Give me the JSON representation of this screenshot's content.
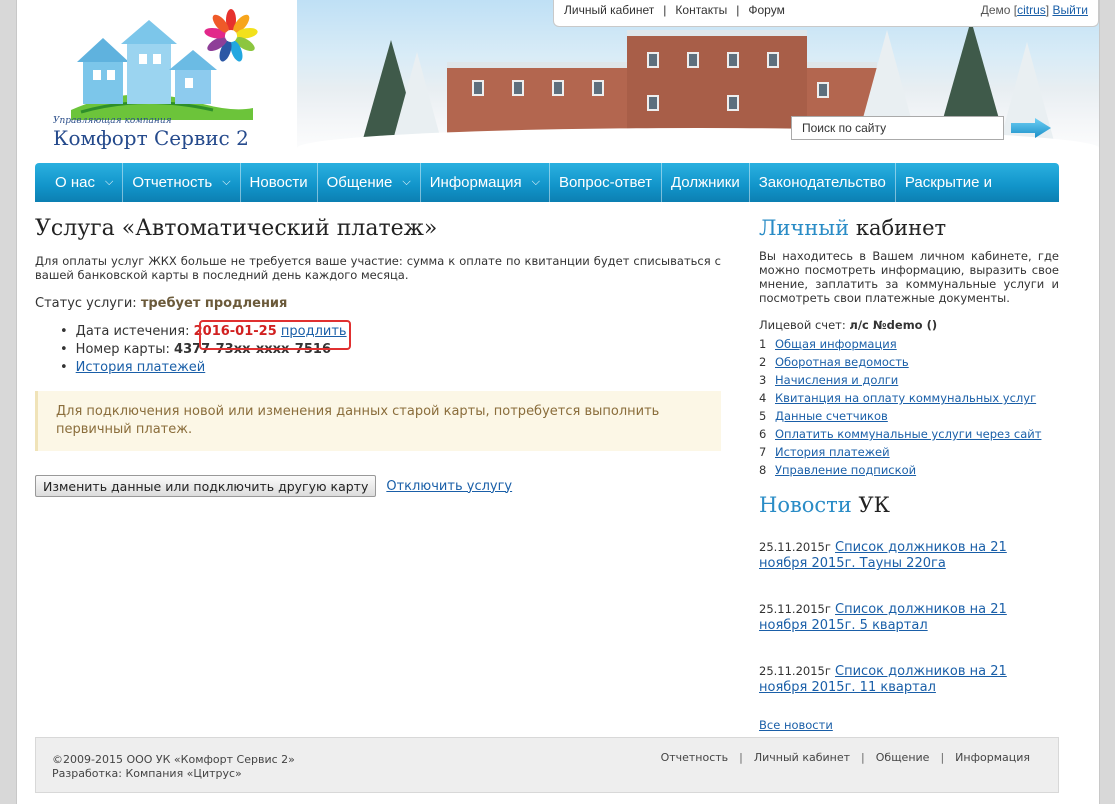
{
  "topnav": {
    "links": [
      "Личный кабинет",
      "Контакты",
      "Форум"
    ],
    "user_name": "Демо",
    "user_login": "citrus",
    "logout": "Выйти"
  },
  "logo": {
    "tagline": "Управляющая компания",
    "name": "Комфорт Сервис 2"
  },
  "search": {
    "placeholder": "Поиск по сайту"
  },
  "mainnav": [
    {
      "label": "О нас",
      "dropdown": true
    },
    {
      "label": "Отчетность",
      "dropdown": true
    },
    {
      "label": "Новости",
      "dropdown": false
    },
    {
      "label": "Общение",
      "dropdown": true
    },
    {
      "label": "Информация",
      "dropdown": true
    },
    {
      "label": "Вопрос-ответ",
      "dropdown": false
    },
    {
      "label": "Должники",
      "dropdown": false
    },
    {
      "label": "Законодательство",
      "dropdown": false
    },
    {
      "label": "Раскрытие и",
      "dropdown": false
    }
  ],
  "main": {
    "title": "Услуга «Автоматический платеж»",
    "intro": "Для оплаты услуг ЖКХ больше не требуется ваше участие: сумма к оплате по квитанции будет списываться с вашей банковской карты в последний день каждого месяца.",
    "status_label": "Статус услуги:",
    "status_value": "требует продления",
    "expiry_label": "Дата истечения:",
    "expiry_date": "2016-01-25",
    "extend_link": "продлить",
    "card_label": "Номер карты:",
    "card_number": "4377-73xx-xxxx-7516",
    "history_link": "История платежей",
    "notice": "Для подключения новой или изменения данных старой карты, потребуется выполнить первичный платеж.",
    "change_button": "Изменить данные или подключить другую карту",
    "disable_link": "Отключить услугу"
  },
  "sidebar": {
    "cabinet_title_accent": "Личный",
    "cabinet_title_rest": "кабинет",
    "cabinet_desc": "Вы находитесь в Вашем личном кабинете, где можно посмотреть информацию, выразить свое мнение, заплатить за коммунальные услуги и посмотреть свои платежные документы.",
    "account_label": "Лицевой счет:",
    "account_value": "л/с №demo ()",
    "menu": [
      {
        "num": "1",
        "label": "Общая информация"
      },
      {
        "num": "2",
        "label": "Оборотная ведомость"
      },
      {
        "num": "3",
        "label": "Начисления и долги"
      },
      {
        "num": "4",
        "label": "Квитанция на оплату коммунальных услуг"
      },
      {
        "num": "5",
        "label": "Данные счетчиков"
      },
      {
        "num": "6",
        "label": "Оплатить коммунальные услуги через сайт"
      },
      {
        "num": "7",
        "label": "История платежей"
      },
      {
        "num": "8",
        "label": "Управление подпиской"
      }
    ],
    "news_title_accent": "Новости",
    "news_title_rest": "УК",
    "news": [
      {
        "date": "25.11.2015г",
        "title": "Список должников на 21 ноября 2015г. Тауны 220га"
      },
      {
        "date": "25.11.2015г",
        "title": "Список должников на 21 ноября 2015г. 5 квартал"
      },
      {
        "date": "25.11.2015г",
        "title": "Список должников на 21 ноября 2015г. 11 квартал"
      }
    ],
    "all_news": "Все новости"
  },
  "footer": {
    "copyright": "©2009-2015 ООО УК «Комфорт Сервис 2»",
    "developer": "Разработка: Компания «Цитрус»",
    "links": [
      "Отчетность",
      "Личный кабинет",
      "Общение",
      "Информация"
    ]
  }
}
